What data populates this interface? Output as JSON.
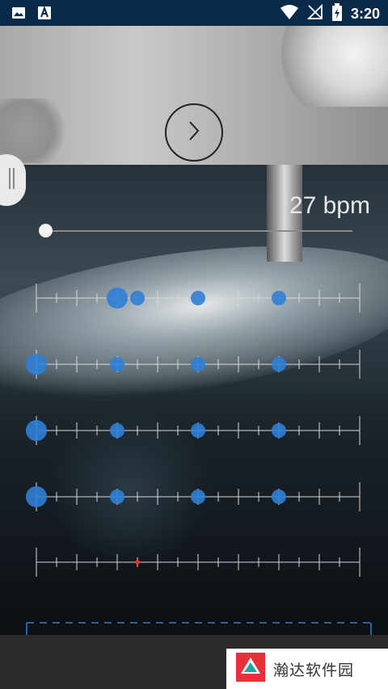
{
  "status_bar": {
    "time": "3:20",
    "icons": [
      "image-icon",
      "text-a-icon",
      "wifi-icon",
      "signal-off-icon",
      "battery-icon"
    ]
  },
  "player": {
    "play_icon": "chevron-right-icon"
  },
  "tempo": {
    "bpm_label": "27 bpm",
    "slider_value": 0
  },
  "beat_grid": {
    "accent_color": "#2f7fd6",
    "cursor_color": "#ff2a2a",
    "rows": [
      {
        "id": "row-1",
        "beats": [
          {
            "pos": 2,
            "size": "large"
          },
          {
            "pos": 2.5,
            "size": "small"
          },
          {
            "pos": 4,
            "size": "small"
          },
          {
            "pos": 6,
            "size": "small"
          }
        ]
      },
      {
        "id": "row-2",
        "beats": [
          {
            "pos": 0,
            "size": "large"
          },
          {
            "pos": 2,
            "size": "small"
          },
          {
            "pos": 4,
            "size": "small"
          },
          {
            "pos": 6,
            "size": "small"
          }
        ]
      },
      {
        "id": "row-3",
        "beats": [
          {
            "pos": 0,
            "size": "large"
          },
          {
            "pos": 2,
            "size": "small"
          },
          {
            "pos": 4,
            "size": "small"
          },
          {
            "pos": 6,
            "size": "small"
          }
        ]
      },
      {
        "id": "row-4",
        "beats": [
          {
            "pos": 0,
            "size": "large"
          },
          {
            "pos": 2,
            "size": "small"
          },
          {
            "pos": 4,
            "size": "small"
          },
          {
            "pos": 6,
            "size": "small"
          }
        ]
      },
      {
        "id": "row-5",
        "beats": [],
        "cursor_pos": 2.5
      }
    ]
  },
  "watermark": {
    "text": "瀚达软件园"
  }
}
